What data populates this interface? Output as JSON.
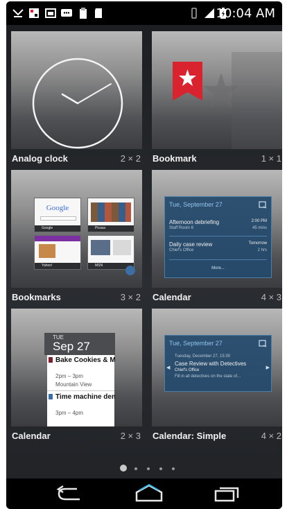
{
  "status_bar": {
    "time": "10:04 AM",
    "icons": [
      "missed-call-icon",
      "app-notification-icon",
      "screenshot-icon",
      "message-icon",
      "clipboard-icon",
      "sd-card-icon",
      "vibrate-icon",
      "signal-4g-icon",
      "battery-icon"
    ]
  },
  "widgets": [
    {
      "name": "Analog clock",
      "size": "2 × 2"
    },
    {
      "name": "Bookmark",
      "size": "1 × 1"
    },
    {
      "name": "Bookmarks",
      "size": "3 × 2"
    },
    {
      "name": "Calendar",
      "size": "4 × 3"
    },
    {
      "name": "Calendar",
      "size": "2 × 3"
    },
    {
      "name": "Calendar: Simple",
      "size": "4 × 2"
    }
  ],
  "bookmarks_preview": {
    "thumbs": [
      "Google",
      "Picasa",
      "Yahoo!",
      "MSN"
    ],
    "logo": "Google"
  },
  "calendar_preview": {
    "header": "Tue, September 27",
    "events": [
      {
        "title": "Afternoon debriefing",
        "location": "Staff Room 6",
        "time": "2:00 PM",
        "duration": "45 mins"
      },
      {
        "title": "Daily case review",
        "location": "Chief's Office",
        "time": "Tomorrow",
        "duration": "2 hrs"
      }
    ],
    "more": "More..."
  },
  "calendar_small_preview": {
    "day": "TUE",
    "date": "Sep 27",
    "events": [
      {
        "title": "Bake Cookies & Make Ice Cream",
        "time": "2pm – 3pm",
        "location": "Mountain View"
      },
      {
        "title": "Time machine demo for Serge",
        "time": "3pm – 4pm"
      }
    ]
  },
  "calendar_simple_preview": {
    "header": "Tue, September 27",
    "date_time": "Tuesday, December 27, 15:30",
    "title": "Case Review with Detectives",
    "location": "Chief's Office",
    "desc": "Fill in all detectives on the state of..."
  },
  "pager": {
    "pages": 5,
    "current": 1
  },
  "colors": {
    "accent_blue": "#33b5e5",
    "bookmark_red": "#d9232e",
    "calendar_blue": "#254a6c"
  }
}
